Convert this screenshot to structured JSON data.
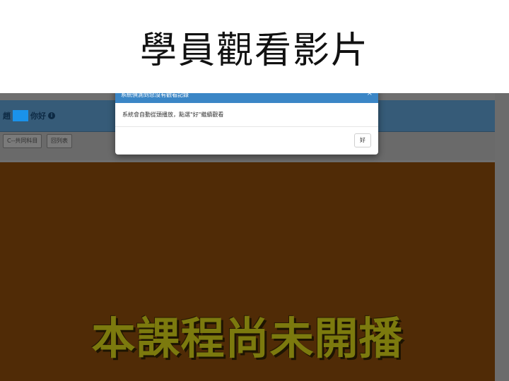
{
  "slide": {
    "title": "學員觀看影片"
  },
  "page": {
    "greeting_prefix": "趙",
    "greeting_suffix": "你好",
    "info_icon": "info-icon",
    "toolbar": {
      "course_button": "C--共同科目",
      "list_button": "回列表"
    }
  },
  "video": {
    "message": "本課程尚未開播",
    "background_color": "#502b06",
    "text_color": "#7c7a0e"
  },
  "modal": {
    "title": "系統偵測到您沒有觀看記錄",
    "body": "系統會自動從頭播放，點選\"好\"繼續觀看",
    "ok_label": "好",
    "header_color": "#3b86c6"
  }
}
